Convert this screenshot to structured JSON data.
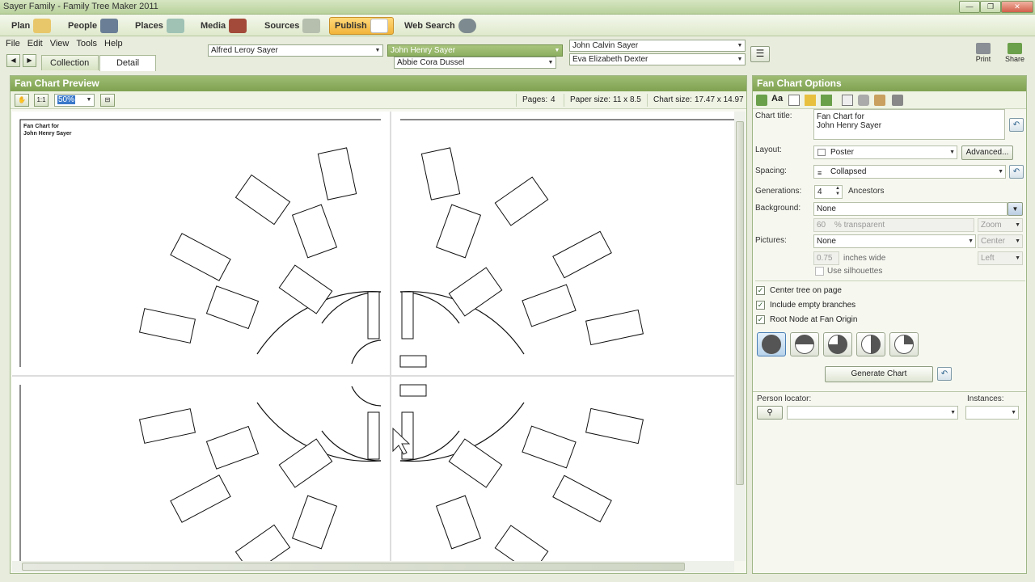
{
  "window": {
    "title": "Sayer Family - Family Tree Maker 2011"
  },
  "nav": {
    "items": [
      "Plan",
      "People",
      "Places",
      "Media",
      "Sources",
      "Publish",
      "Web Search"
    ],
    "active": "Publish"
  },
  "menu": {
    "items": [
      "File",
      "Edit",
      "View",
      "Tools",
      "Help"
    ]
  },
  "tabs": {
    "collection": "Collection",
    "detail": "Detail"
  },
  "family": {
    "father": "Alfred Leroy Sayer",
    "selected": "John Henry Sayer",
    "mother": "Abbie Cora Dussel",
    "spouse_father": "John Calvin Sayer",
    "spouse_mother": "Eva Elizabeth Dexter"
  },
  "right_tools": {
    "print": "Print",
    "share": "Share"
  },
  "preview": {
    "header": "Fan Chart Preview",
    "zoom": "50%",
    "pages_label": "Pages:",
    "pages_value": "4",
    "paper_label": "Paper size:",
    "paper_value": "11 x 8.5",
    "chart_label": "Chart size:",
    "chart_value": "17.47 x 14.97",
    "chart_title_line1": "Fan Chart for",
    "chart_title_line2": "John Henry Sayer"
  },
  "options": {
    "header": "Fan Chart Options",
    "chart_title_label": "Chart title:",
    "chart_title_line1": "Fan Chart for",
    "chart_title_line2": "John Henry Sayer",
    "layout_label": "Layout:",
    "layout_value": "Poster",
    "advanced_button": "Advanced...",
    "spacing_label": "Spacing:",
    "spacing_value": "Collapsed",
    "generations_label": "Generations:",
    "generations_value": "4",
    "generations_unit": "Ancestors",
    "background_label": "Background:",
    "background_value": "None",
    "transparency_value": "60",
    "transparency_label": "% transparent",
    "bg_fit": "Zoom",
    "pictures_label": "Pictures:",
    "pictures_value": "None",
    "pic_align": "Center",
    "width_value": "0.75",
    "width_label": "inches wide",
    "pic_side": "Left",
    "silhouettes_label": "Use silhouettes",
    "center_tree_label": "Center tree on page",
    "empty_branches_label": "Include empty branches",
    "root_node_label": "Root Node at Fan Origin",
    "generate_button": "Generate Chart",
    "person_locator_label": "Person locator:",
    "instances_label": "Instances:"
  },
  "colors": {
    "accent": "#8daf60",
    "publish": "#f2b43a",
    "panel_header": "#7fa150"
  }
}
